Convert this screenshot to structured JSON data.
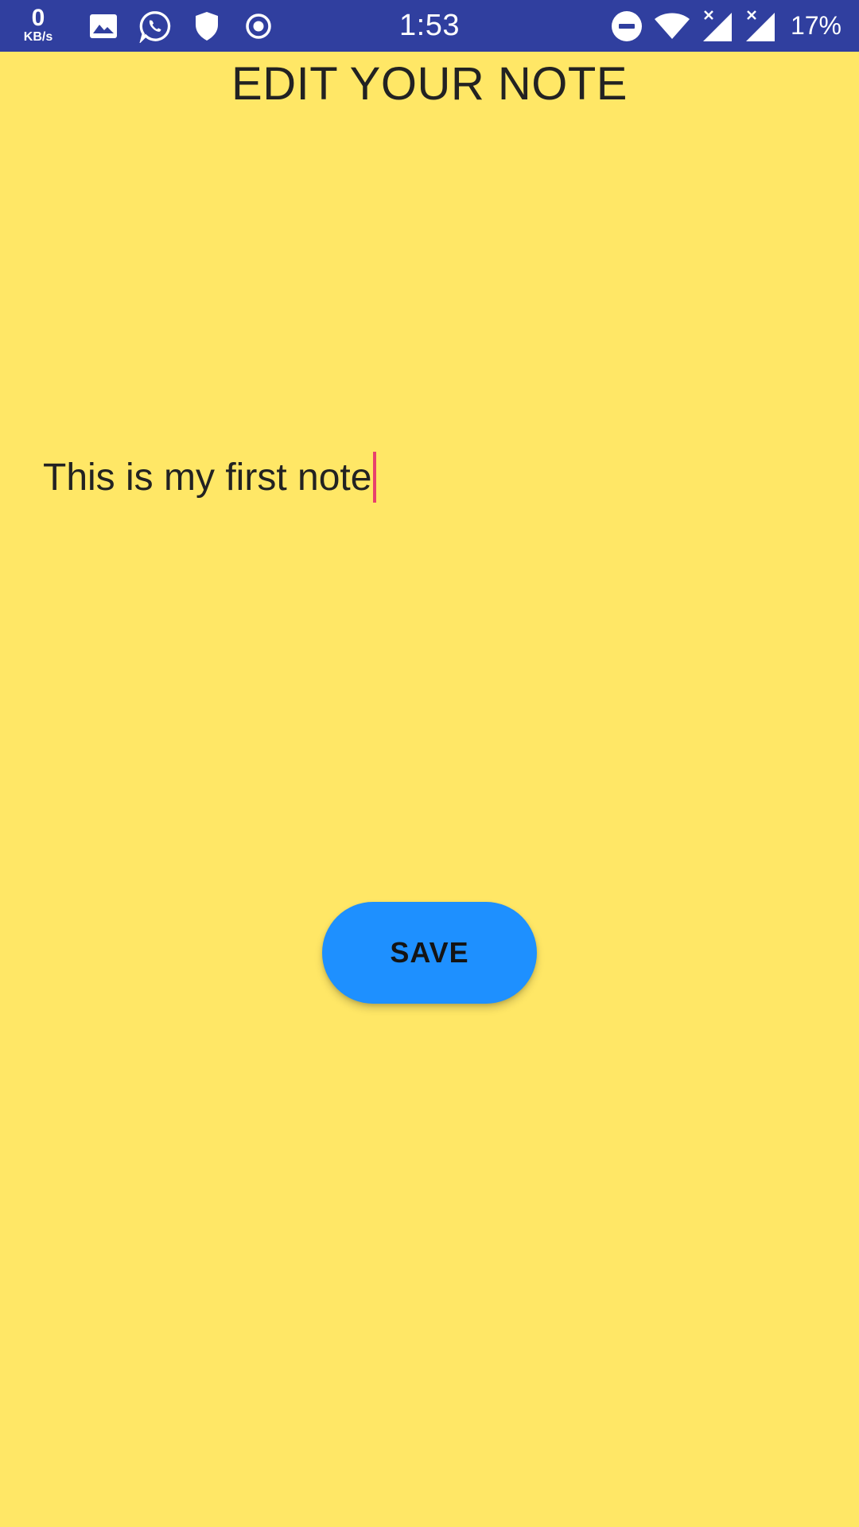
{
  "status_bar": {
    "net_speed_value": "0",
    "net_speed_unit": "KB/s",
    "time": "1:53",
    "battery": "17%",
    "left_icons": [
      "image-icon",
      "whatsapp-icon",
      "shield-icon",
      "record-icon"
    ],
    "right_icons": [
      "do-not-disturb-icon",
      "wifi-icon",
      "signal-no-service-icon",
      "signal-no-service-icon"
    ],
    "background_color": "#303F9F"
  },
  "page": {
    "title": "EDIT YOUR NOTE",
    "background_color": "#FFE766"
  },
  "note": {
    "value": "This is my first note",
    "cursor_color": "#E8416D"
  },
  "save_button": {
    "label": "SAVE",
    "color": "#1E90FF"
  }
}
